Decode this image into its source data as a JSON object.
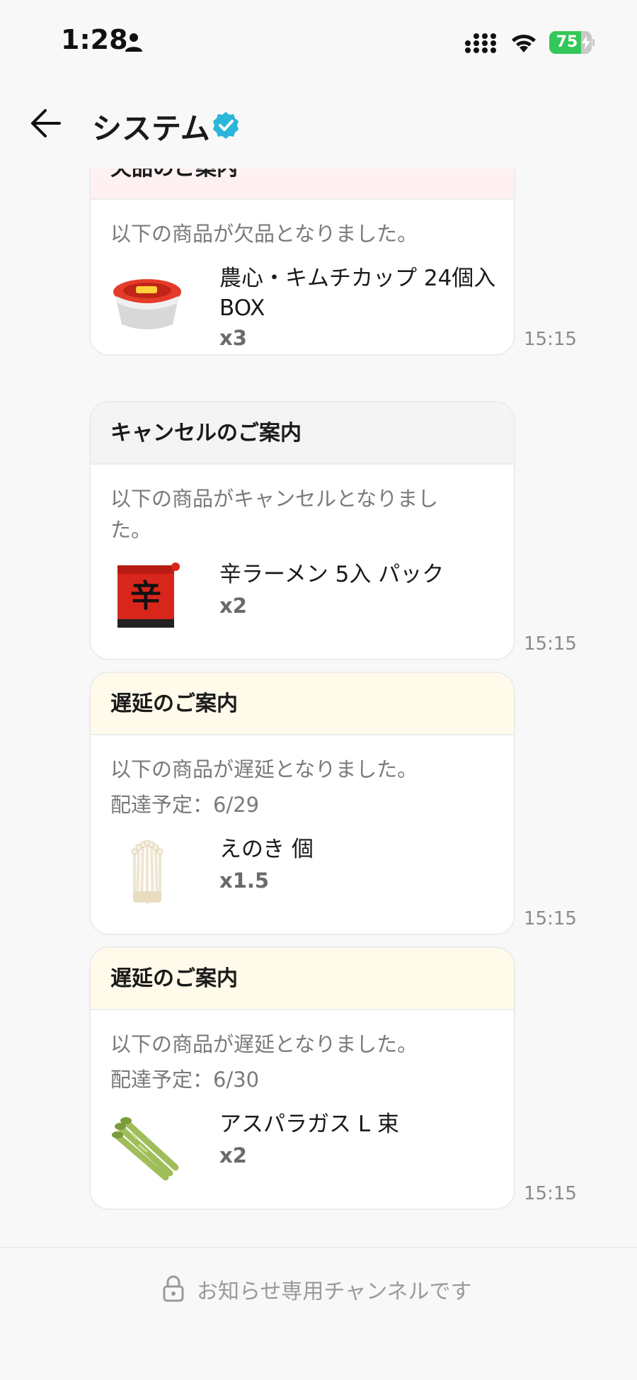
{
  "status_bar": {
    "time": "1:28",
    "battery_percent": "75",
    "battery_level": 0.75,
    "icons": [
      "person-icon",
      "signal-icon",
      "wifi-icon",
      "battery-icon",
      "bolt-icon"
    ]
  },
  "header": {
    "title": "システム",
    "icons": [
      "back-arrow-icon",
      "verified-badge-icon"
    ],
    "verified_color": "#29b6d9"
  },
  "messages": [
    {
      "heading": "欠品のご案内",
      "heading_color": "#fff1f1",
      "body": "以下の商品が欠品となりました。",
      "delivery": "",
      "product_name": "農心・キムチカップ 24個入 BOX",
      "quantity": "x3",
      "time": "15:15",
      "thumb_icon": "kimchi-cup-noodle-image"
    },
    {
      "heading": "キャンセルのご案内",
      "heading_color": "#f4f4f4",
      "body": "以下の商品がキャンセルとなりました。",
      "delivery": "",
      "product_name": "辛ラーメン 5入 パック",
      "quantity": "x2",
      "time": "15:15",
      "thumb_icon": "shin-ramyun-pack-image"
    },
    {
      "heading": "遅延のご案内",
      "heading_color": "#fffaea",
      "body": "以下の商品が遅延となりました。",
      "delivery": "配達予定：6/29",
      "product_name": "えのき 個",
      "quantity": "x1.5",
      "time": "15:15",
      "thumb_icon": "enoki-mushroom-image"
    },
    {
      "heading": "遅延のご案内",
      "heading_color": "#fffaea",
      "body": "以下の商品が遅延となりました。",
      "delivery": "配達予定：6/30",
      "product_name": "アスパラガス L 束",
      "quantity": "x2",
      "time": "15:15",
      "thumb_icon": "asparagus-image"
    }
  ],
  "footer": {
    "notice": "お知らせ専用チャンネルです",
    "icon": "lock-icon"
  },
  "colors": {
    "background": "#f8f8f8",
    "card": "#ffffff",
    "battery_green": "#34c759"
  }
}
